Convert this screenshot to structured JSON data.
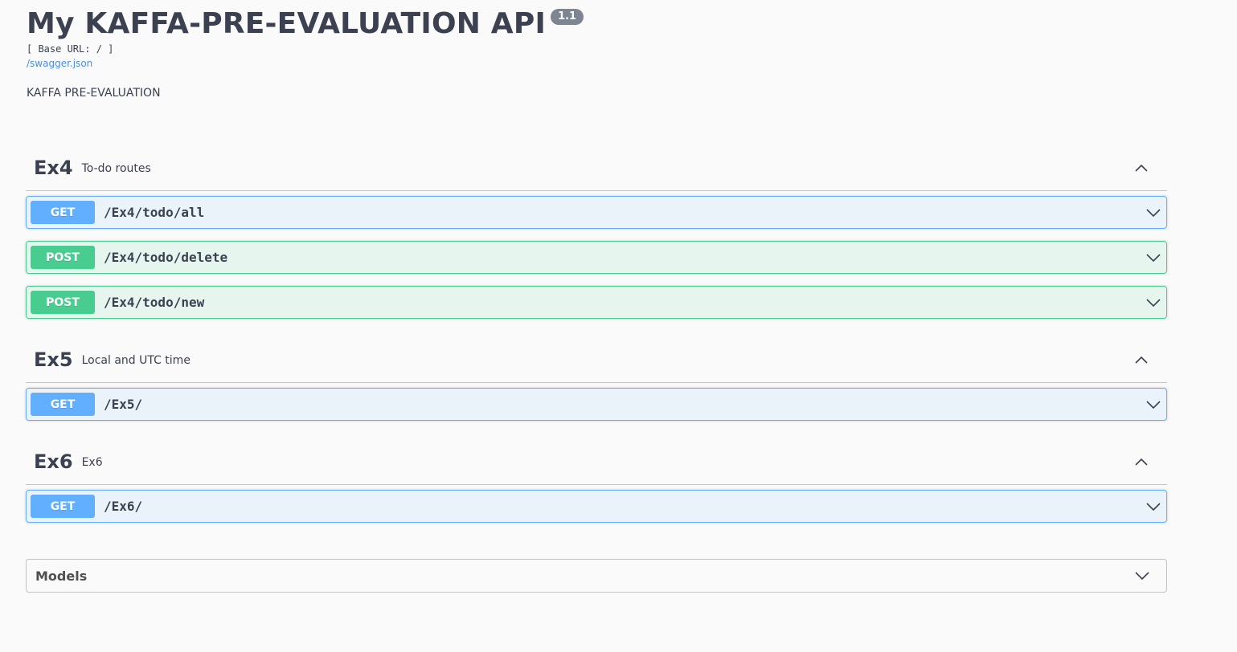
{
  "info": {
    "title": "My KAFFA-PRE-EVALUATION API",
    "version": "1.1",
    "base_url": "[ Base URL: / ]",
    "spec_link": "/swagger.json",
    "description": "KAFFA PRE-EVALUATION"
  },
  "colors": {
    "get": "#61affe",
    "post": "#49cc90",
    "link": "#4990e2",
    "text": "#3b4151"
  },
  "tags": [
    {
      "name": "Ex4",
      "description": "To-do routes",
      "toggle_icon": "chevron-up-icon",
      "operations": [
        {
          "method": "GET",
          "path": "/Ex4/todo/all",
          "toggle_icon": "chevron-down-icon"
        },
        {
          "method": "POST",
          "path": "/Ex4/todo/delete",
          "toggle_icon": "chevron-down-icon"
        },
        {
          "method": "POST",
          "path": "/Ex4/todo/new",
          "toggle_icon": "chevron-down-icon"
        }
      ]
    },
    {
      "name": "Ex5",
      "description": "Local and UTC time",
      "toggle_icon": "chevron-up-icon",
      "operations": [
        {
          "method": "GET",
          "path": "/Ex5/",
          "toggle_icon": "chevron-down-icon"
        }
      ]
    },
    {
      "name": "Ex6",
      "description": "Ex6",
      "toggle_icon": "chevron-up-icon",
      "operations": [
        {
          "method": "GET",
          "path": "/Ex6/",
          "toggle_icon": "chevron-down-icon"
        }
      ]
    }
  ],
  "models": {
    "title": "Models",
    "toggle_icon": "chevron-down-icon"
  }
}
